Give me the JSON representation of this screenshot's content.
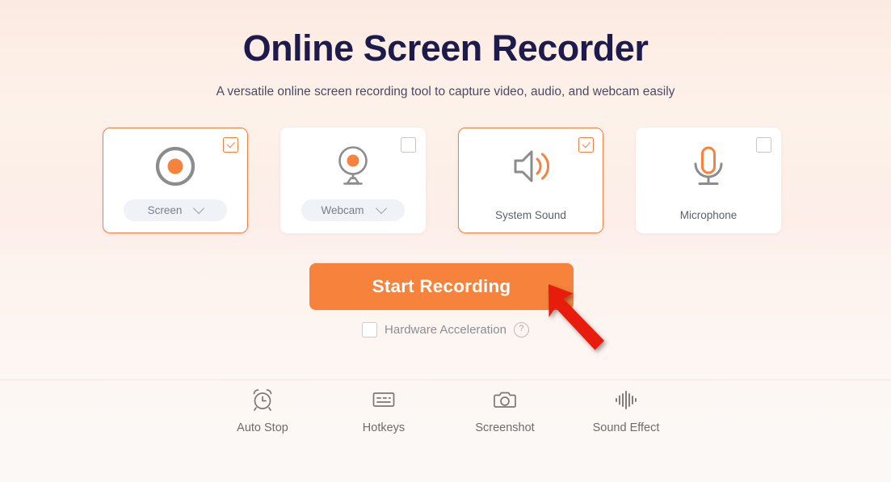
{
  "header": {
    "title": "Online Screen Recorder",
    "subtitle": "A versatile online screen recording tool to capture video, audio, and webcam easily"
  },
  "colors": {
    "accent": "#f6823c",
    "title": "#1d1b4c",
    "card_border_selected": "#ef8144",
    "icon_gray": "#888888",
    "arrow": "#e71b0e"
  },
  "options": [
    {
      "id": "screen",
      "icon": "record-circle-icon",
      "label": "Screen",
      "checked": true,
      "has_dropdown": true
    },
    {
      "id": "webcam",
      "icon": "webcam-icon",
      "label": "Webcam",
      "checked": false,
      "has_dropdown": true
    },
    {
      "id": "system-sound",
      "icon": "speaker-icon",
      "label": "System Sound",
      "checked": true,
      "has_dropdown": false
    },
    {
      "id": "microphone",
      "icon": "microphone-icon",
      "label": "Microphone",
      "checked": false,
      "has_dropdown": false
    }
  ],
  "start_button": {
    "label": "Start Recording"
  },
  "hardware_acceleration": {
    "label": "Hardware Acceleration",
    "checked": false,
    "help": "?"
  },
  "tools": [
    {
      "id": "auto-stop",
      "icon": "alarm-clock-icon",
      "label": "Auto Stop"
    },
    {
      "id": "hotkeys",
      "icon": "keyboard-icon",
      "label": "Hotkeys"
    },
    {
      "id": "screenshot",
      "icon": "camera-icon",
      "label": "Screenshot"
    },
    {
      "id": "sound-effect",
      "icon": "waveform-icon",
      "label": "Sound Effect"
    }
  ]
}
